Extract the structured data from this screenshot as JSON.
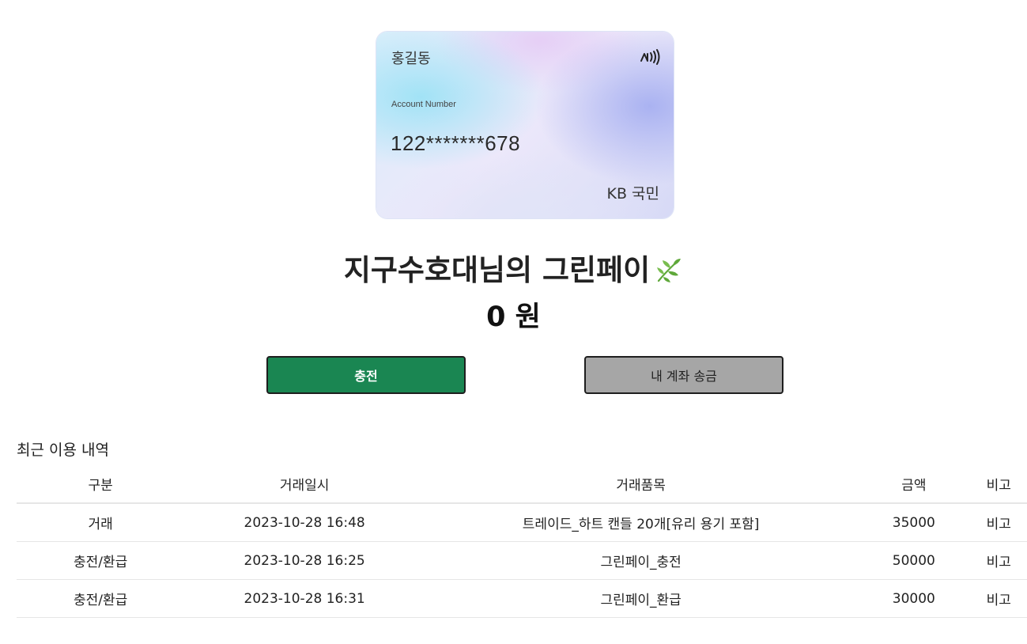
{
  "card": {
    "holder": "홍길동",
    "account_label": "Account Number",
    "account_number": "122*******678",
    "bank": "KB 국민",
    "icons": [
      "nfc-contactless-icon"
    ]
  },
  "title": "지구수호대님의 그린페이",
  "title_icon": "leaf-icon",
  "balance": "0 원",
  "buttons": {
    "charge": "충전",
    "transfer": "내 계좌 송금"
  },
  "colors": {
    "charge_button": "#1a8652",
    "transfer_button": "#a6a6a6",
    "leaf": "#5fa83a"
  },
  "history": {
    "title": "최근 이용 내역",
    "columns": [
      "구분",
      "거래일시",
      "거래품목",
      "금액",
      "비고"
    ],
    "rows": [
      [
        "거래",
        "2023-10-28 16:48",
        "트레이드_하트 캔들 20개[유리 용기 포함]",
        "35000",
        "비고"
      ],
      [
        "충전/환급",
        "2023-10-28 16:25",
        "그린페이_충전",
        "50000",
        "비고"
      ],
      [
        "충전/환급",
        "2023-10-28 16:31",
        "그린페이_환급",
        "30000",
        "비고"
      ]
    ]
  }
}
